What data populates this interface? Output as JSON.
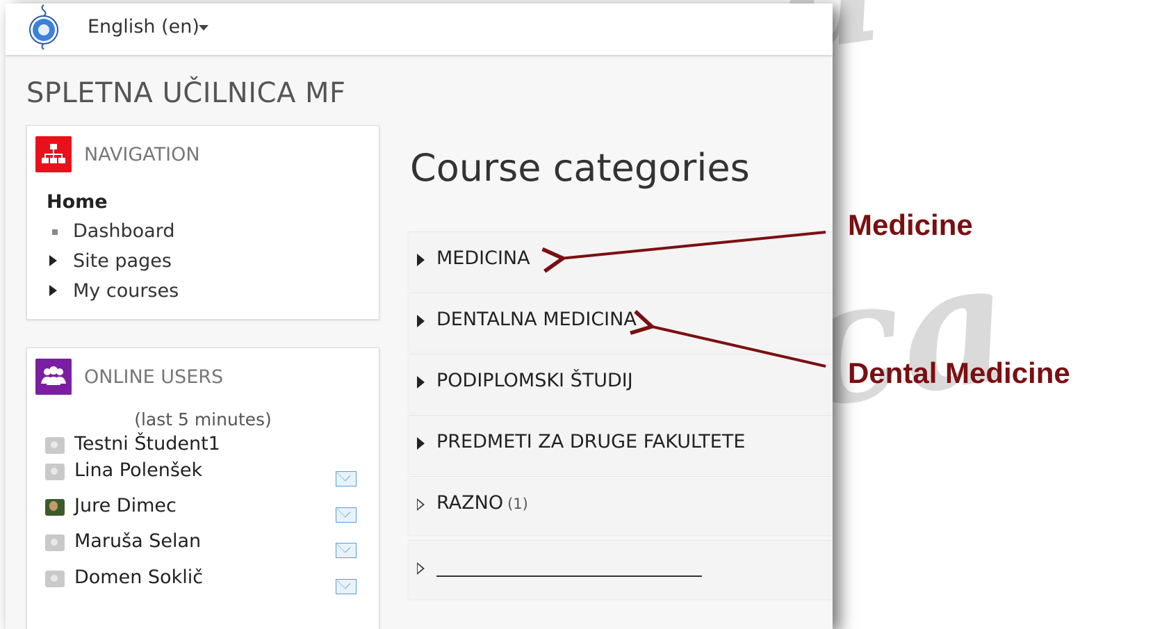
{
  "header": {
    "language_label": "English (en)",
    "logo_icon": "university-seal-icon"
  },
  "site_title": "SPLETNA UČILNICA MF",
  "navigation_block": {
    "title": "NAVIGATION",
    "icon": "sitemap-icon",
    "icon_color": "#e8111b",
    "home": "Home",
    "items": [
      {
        "label": "Dashboard",
        "marker": "bullet"
      },
      {
        "label": "Site pages",
        "marker": "expand-triangle"
      },
      {
        "label": "My courses",
        "marker": "expand-triangle"
      }
    ]
  },
  "online_users_block": {
    "title": "ONLINE USERS",
    "icon": "users-icon",
    "icon_color": "#7b1fa2",
    "subtitle": "(last 5 minutes)",
    "users": [
      {
        "name": "Testni Študent1",
        "picture": "default-avatar",
        "message_icon": false
      },
      {
        "name": "Lina Polenšek",
        "picture": "default-avatar",
        "message_icon": true
      },
      {
        "name": "Jure Dimec",
        "picture": "photo-avatar",
        "message_icon": true
      },
      {
        "name": "Maruša Selan",
        "picture": "default-avatar",
        "message_icon": true
      },
      {
        "name": "Domen Soklič",
        "picture": "default-avatar",
        "message_icon": true
      }
    ]
  },
  "main": {
    "title": "Course categories",
    "categories": [
      {
        "name": "MEDICINA",
        "count": "",
        "expandable": true
      },
      {
        "name": "DENTALNA MEDICINA",
        "count": "",
        "expandable": true
      },
      {
        "name": "PODIPLOMSKI ŠTUDIJ",
        "count": "",
        "expandable": true
      },
      {
        "name": "PREDMETI ZA DRUGE FAKULTETE",
        "count": "",
        "expandable": true
      },
      {
        "name": "RAZNO",
        "count": "(1)",
        "expandable": false
      },
      {
        "name": "",
        "count": "",
        "expandable": false
      }
    ]
  },
  "annotations": {
    "medicine": "Medicine",
    "dental_medicine": "Dental Medicine",
    "color": "#7a0f12"
  }
}
